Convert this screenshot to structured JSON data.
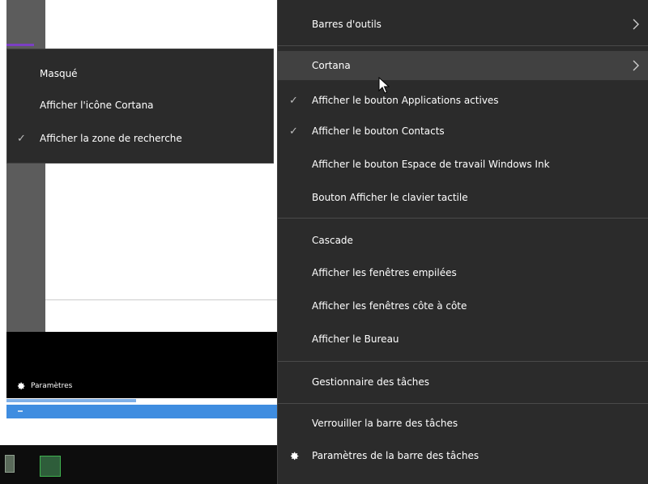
{
  "background": {
    "settings_label": "Paramètres"
  },
  "submenu": {
    "items": [
      {
        "label": "Masqué",
        "checked": false
      },
      {
        "label": "Afficher l'icône Cortana",
        "checked": false
      },
      {
        "label": "Afficher la zone de recherche",
        "checked": true
      }
    ]
  },
  "menu": {
    "items": [
      {
        "label": "Barres d'outils",
        "has_submenu": true
      },
      {
        "label": "Cortana",
        "has_submenu": true,
        "highlighted": true
      },
      {
        "label": "Afficher le bouton Applications actives",
        "checked": true
      },
      {
        "label": "Afficher le bouton Contacts",
        "checked": true
      },
      {
        "label": "Afficher le bouton Espace de travail Windows Ink"
      },
      {
        "label": "Bouton Afficher le clavier tactile"
      },
      {
        "label": "Cascade"
      },
      {
        "label": "Afficher les fenêtres empilées"
      },
      {
        "label": "Afficher les fenêtres côte à côte"
      },
      {
        "label": "Afficher le Bureau"
      },
      {
        "label": "Gestionnaire des tâches"
      },
      {
        "label": "Verrouiller la barre des tâches"
      },
      {
        "label": "Paramètres de la barre des tâches",
        "icon": "gear-icon"
      }
    ]
  },
  "colors": {
    "menu_bg": "#2b2b2b",
    "highlight_bg": "#414141",
    "text": "#ffffff",
    "accent_blue": "#3f8de0",
    "accent_purple": "#7b3fc4"
  }
}
